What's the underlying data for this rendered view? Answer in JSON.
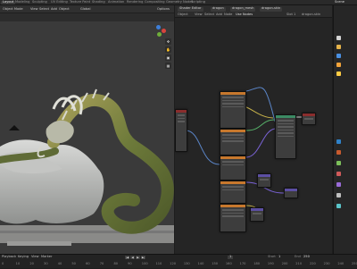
{
  "app": {
    "name": "Blender"
  },
  "workspace_tabs": [
    "Layout",
    "Modeling",
    "Sculpting",
    "UV Editing",
    "Texture Paint",
    "Shading",
    "Animation",
    "Rendering",
    "Compositing",
    "Geometry Nodes",
    "Scripting"
  ],
  "active_tab_index": 0,
  "viewport": {
    "mode": "Object Mode",
    "menus": [
      "View",
      "Select",
      "Add",
      "Object"
    ],
    "overlay_label": "Global",
    "options_label": "Options",
    "icons": [
      "move-icon",
      "rotate-icon",
      "grab-hand-icon",
      "camera-icon",
      "grid-icon"
    ],
    "gizmo_axes": [
      "X",
      "Y",
      "Z"
    ]
  },
  "node_editor": {
    "type": "Shader Editor",
    "menus": [
      "View",
      "Select",
      "Add",
      "Node"
    ],
    "mode": "Object",
    "slot": "Slot 1",
    "material": "dragon-skin",
    "use_nodes_label": "Use Nodes",
    "breadcrumb": [
      "dragon",
      "dragon_mesh",
      "dragon-skin"
    ],
    "sidebar_tabs": [
      "Node",
      "Tool",
      "View",
      "Options"
    ],
    "accent_colors": {
      "header_orange": "#c7782d",
      "header_purple": "#5c4fa3",
      "header_green": "#3c8a63",
      "header_red": "#8a2d2d",
      "link_yellow": "#c9b34a",
      "link_purple": "#7a63d6",
      "link_green": "#57b36a",
      "link_blue": "#5b86c9"
    }
  },
  "right_panel": {
    "header": "Scene",
    "items": [
      "Scene Collection",
      "Collection",
      "Camera",
      "dragon",
      "Light"
    ],
    "icon_colors": [
      "#d4d4d4",
      "#e6b34a",
      "#4a90e2",
      "#f1a33a",
      "#ffcc44",
      "#2f82c9",
      "#c95a2e",
      "#7cbf5a",
      "#d05a5a",
      "#9a6bd8",
      "#bfbfbf",
      "#5ac4c9"
    ]
  },
  "timeline": {
    "menus": [
      "Playback",
      "Keying",
      "View",
      "Marker"
    ],
    "ticks": [
      "0",
      "10",
      "20",
      "30",
      "40",
      "50",
      "60",
      "70",
      "80",
      "90",
      "100",
      "110",
      "120",
      "130",
      "140",
      "150",
      "160",
      "170",
      "180",
      "190",
      "200",
      "210",
      "220",
      "230",
      "240",
      "250"
    ],
    "current_frame": "1",
    "start_label": "Start",
    "start": "1",
    "end_label": "End",
    "end": "250"
  }
}
